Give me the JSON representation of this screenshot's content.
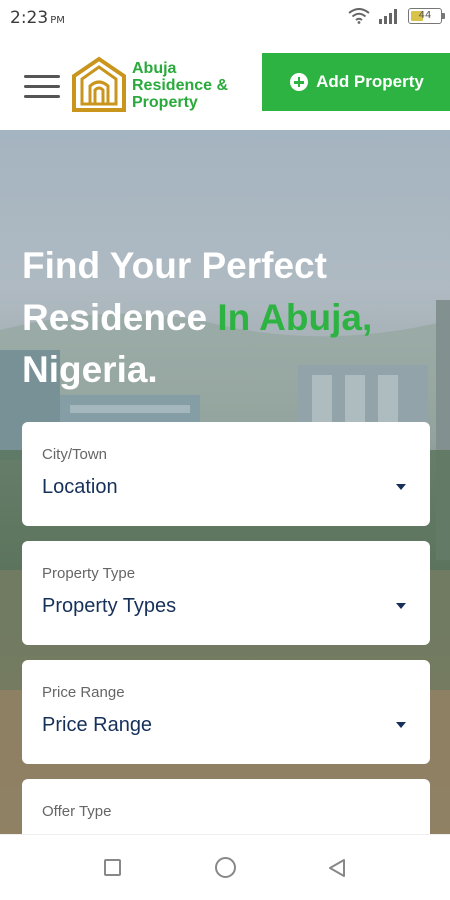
{
  "status_bar": {
    "time": "2:23",
    "ampm": "PM",
    "battery": "44"
  },
  "header": {
    "logo_line1": "Abuja",
    "logo_line2": "Residence &",
    "logo_line3": "Property",
    "add_property_label": "Add Property"
  },
  "hero": {
    "title_part1": "Find Your Perfect Residence ",
    "title_accent": "In Abuja,",
    "title_part2": " Nigeria."
  },
  "search": {
    "fields": [
      {
        "label": "City/Town",
        "value": "Location"
      },
      {
        "label": "Property Type",
        "value": "Property Types"
      },
      {
        "label": "Price Range",
        "value": "Price Range"
      },
      {
        "label": "Offer Type",
        "value": ""
      }
    ]
  },
  "colors": {
    "brand_green": "#2cb341",
    "logo_gold": "#c9951c",
    "field_text": "#16305a"
  },
  "icons": [
    "wifi-icon",
    "signal-icon",
    "battery-icon",
    "menu-icon",
    "plus-circle-icon",
    "caret-down-icon",
    "recent-apps-icon",
    "home-icon",
    "back-icon"
  ]
}
